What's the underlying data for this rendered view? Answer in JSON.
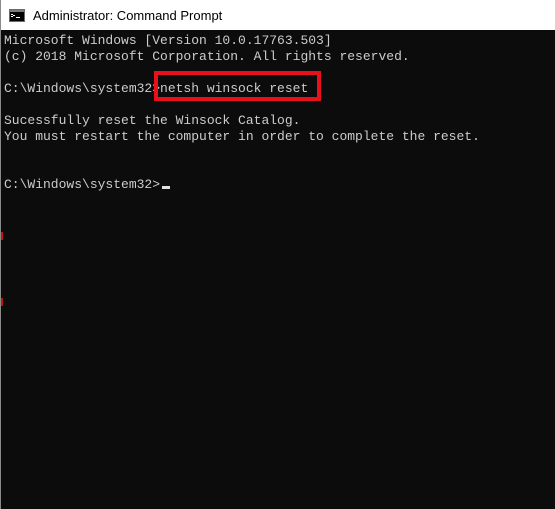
{
  "window": {
    "title": "Administrator: Command Prompt",
    "icon": "command-prompt-icon"
  },
  "console": {
    "lines": [
      "Microsoft Windows [Version 10.0.17763.503]",
      "(c) 2018 Microsoft Corporation. All rights reserved.",
      "",
      "C:\\Windows\\system32>netsh winsock reset",
      "",
      "Sucessfully reset the Winsock Catalog.",
      "You must restart the computer in order to complete the reset.",
      "",
      "",
      "C:\\Windows\\system32>"
    ]
  },
  "colors": {
    "console_background": "#0c0c0c",
    "console_text": "#cccccc",
    "highlight": "#e8101a",
    "titlebar_background": "#ffffff"
  }
}
